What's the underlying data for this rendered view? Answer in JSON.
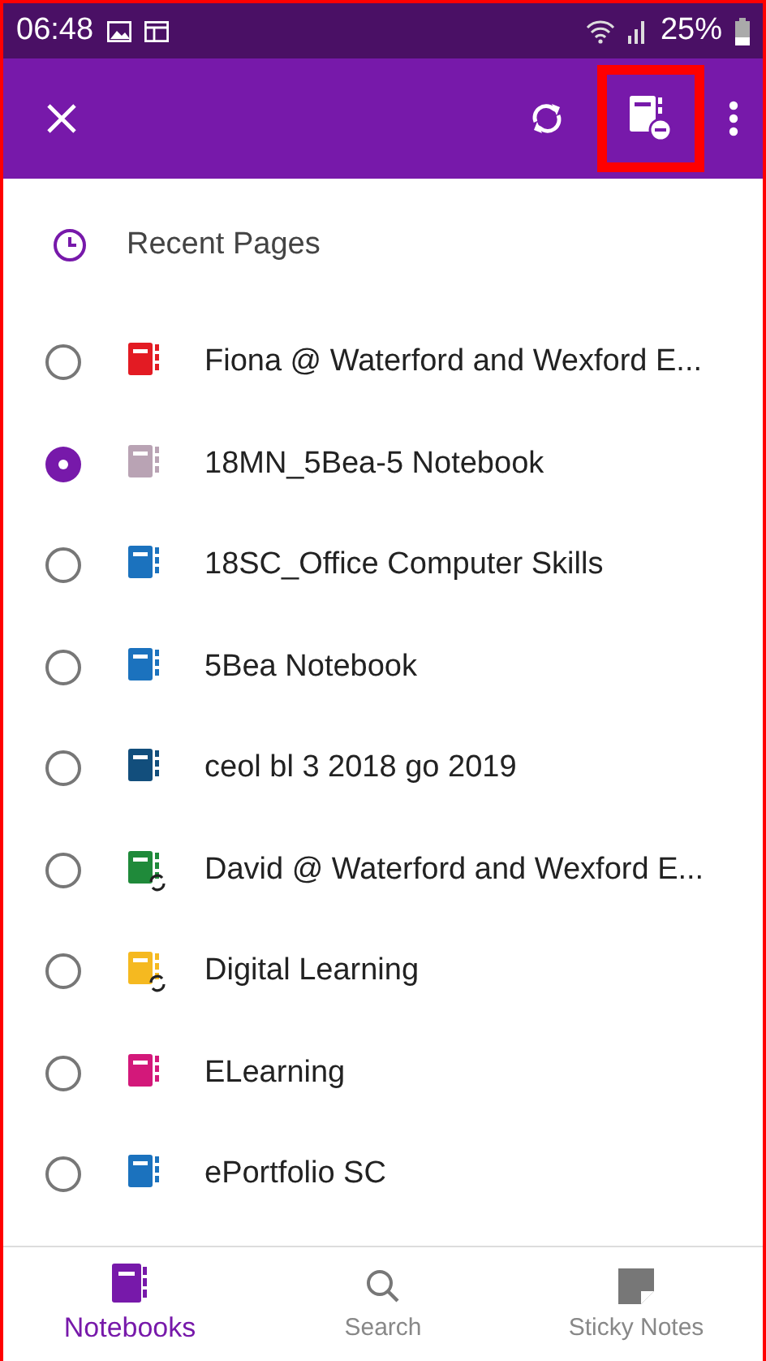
{
  "status_bar": {
    "time": "06:48",
    "battery": "25%"
  },
  "toolbar": {
    "remove_button_highlighted": true
  },
  "recent": {
    "label": "Recent Pages"
  },
  "notebooks": [
    {
      "name": "Fiona @ Waterford and Wexford E...",
      "selected": false,
      "color": "#e31b23",
      "syncing": false
    },
    {
      "name": "18MN_5Bea-5 Notebook",
      "selected": true,
      "color": "#b9a3b4",
      "syncing": false
    },
    {
      "name": "18SC_Office Computer Skills",
      "selected": false,
      "color": "#1b72be",
      "syncing": false
    },
    {
      "name": "5Bea Notebook",
      "selected": false,
      "color": "#1b72be",
      "syncing": false
    },
    {
      "name": "ceol bl 3 2018 go 2019",
      "selected": false,
      "color": "#124e7c",
      "syncing": false
    },
    {
      "name": "David @ Waterford and Wexford E...",
      "selected": false,
      "color": "#1f8a3a",
      "syncing": true
    },
    {
      "name": "Digital Learning",
      "selected": false,
      "color": "#f5b920",
      "syncing": true
    },
    {
      "name": "ELearning",
      "selected": false,
      "color": "#d3187a",
      "syncing": false
    },
    {
      "name": "ePortfolio SC",
      "selected": false,
      "color": "#1b72be",
      "syncing": false
    }
  ],
  "bottom_nav": [
    {
      "label": "Notebooks",
      "kind": "notebooks",
      "selected": true
    },
    {
      "label": "Search",
      "kind": "search",
      "selected": false
    },
    {
      "label": "Sticky Notes",
      "kind": "sticky",
      "selected": false
    }
  ]
}
